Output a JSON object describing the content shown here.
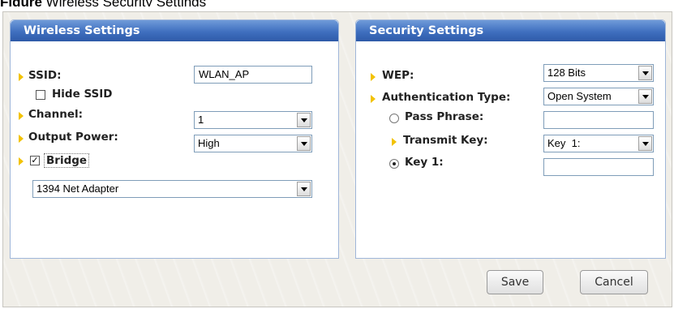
{
  "caption": {
    "figure_label": "Figure",
    "text": " Wireless Security Settings"
  },
  "wireless": {
    "title": "Wireless Settings",
    "ssid_label": "SSID:",
    "ssid_value": "WLAN_AP",
    "hide_ssid_label": "Hide SSID",
    "hide_ssid_checked": false,
    "channel_label": "Channel:",
    "channel_value": "1",
    "output_power_label": "Output Power:",
    "output_power_value": "High",
    "bridge_label": "Bridge",
    "bridge_checked": true,
    "bridge_adapter_value": "1394 Net Adapter"
  },
  "security": {
    "title": "Security Settings",
    "wep_label": "WEP:",
    "wep_value": "128 Bits",
    "auth_type_label": "Authentication Type:",
    "auth_type_value": "Open System",
    "pass_phrase_label": "Pass Phrase:",
    "pass_phrase_value": "",
    "transmit_key_label": "Transmit Key:",
    "transmit_key_value": "Key  1:",
    "key1_label": "Key 1:",
    "key1_value": "",
    "key_mode_selected": "key1"
  },
  "buttons": {
    "save_label": "Save",
    "cancel_label": "Cancel"
  },
  "colors": {
    "header_blue": "#3f6fbf",
    "arrow_yellow": "#f2c200",
    "panel_border": "#9fb6d9"
  }
}
